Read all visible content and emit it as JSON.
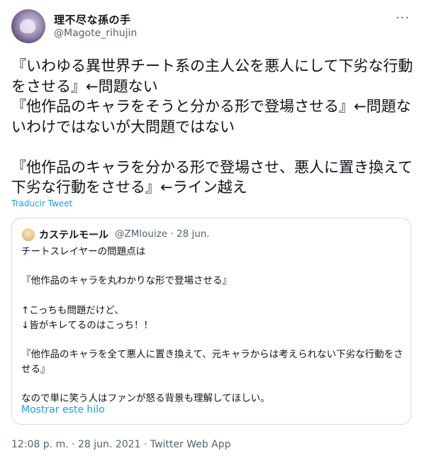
{
  "tweet": {
    "author_name": "理不尽な孫の手",
    "author_handle": "@Magote_rihujin",
    "more_glyph": "···",
    "text": "『いわゆる異世界チート系の主人公を悪人にして下劣な行動をさせる』←問題ない\n『他作品のキャラをそうと分かる形で登場させる』←問題ないわけではないが大問題ではない\n\n『他作品のキャラを分かる形で登場させ、悪人に置き換えて下劣な行動をさせる』←ライン越え",
    "translate_label": "Traducir Tweet",
    "timestamp": "12:08 p. m. · 28 jun. 2021 · Twitter Web App"
  },
  "quote": {
    "author_name": "カステルモール",
    "meta": "@ZMlouize · 28 jun.",
    "text": "チートスレイヤーの問題点は\n\n『他作品のキャラを丸わかりな形で登場させる』\n\n↑こっちも問題だけど、\n↓皆がキレてるのはこっち！！\n\n『他作品のキャラを全て悪人に置き換えて、元キャラからは考えられない下劣な行動をさせる』\n\nなので単に笑う人はファンが怒る背景も理解してほしい。",
    "show_thread_label": "Mostrar este hilo"
  },
  "colors": {
    "link": "#1d9bf0",
    "text": "#0f1419",
    "muted": "#536471",
    "border": "#cfd9de"
  }
}
